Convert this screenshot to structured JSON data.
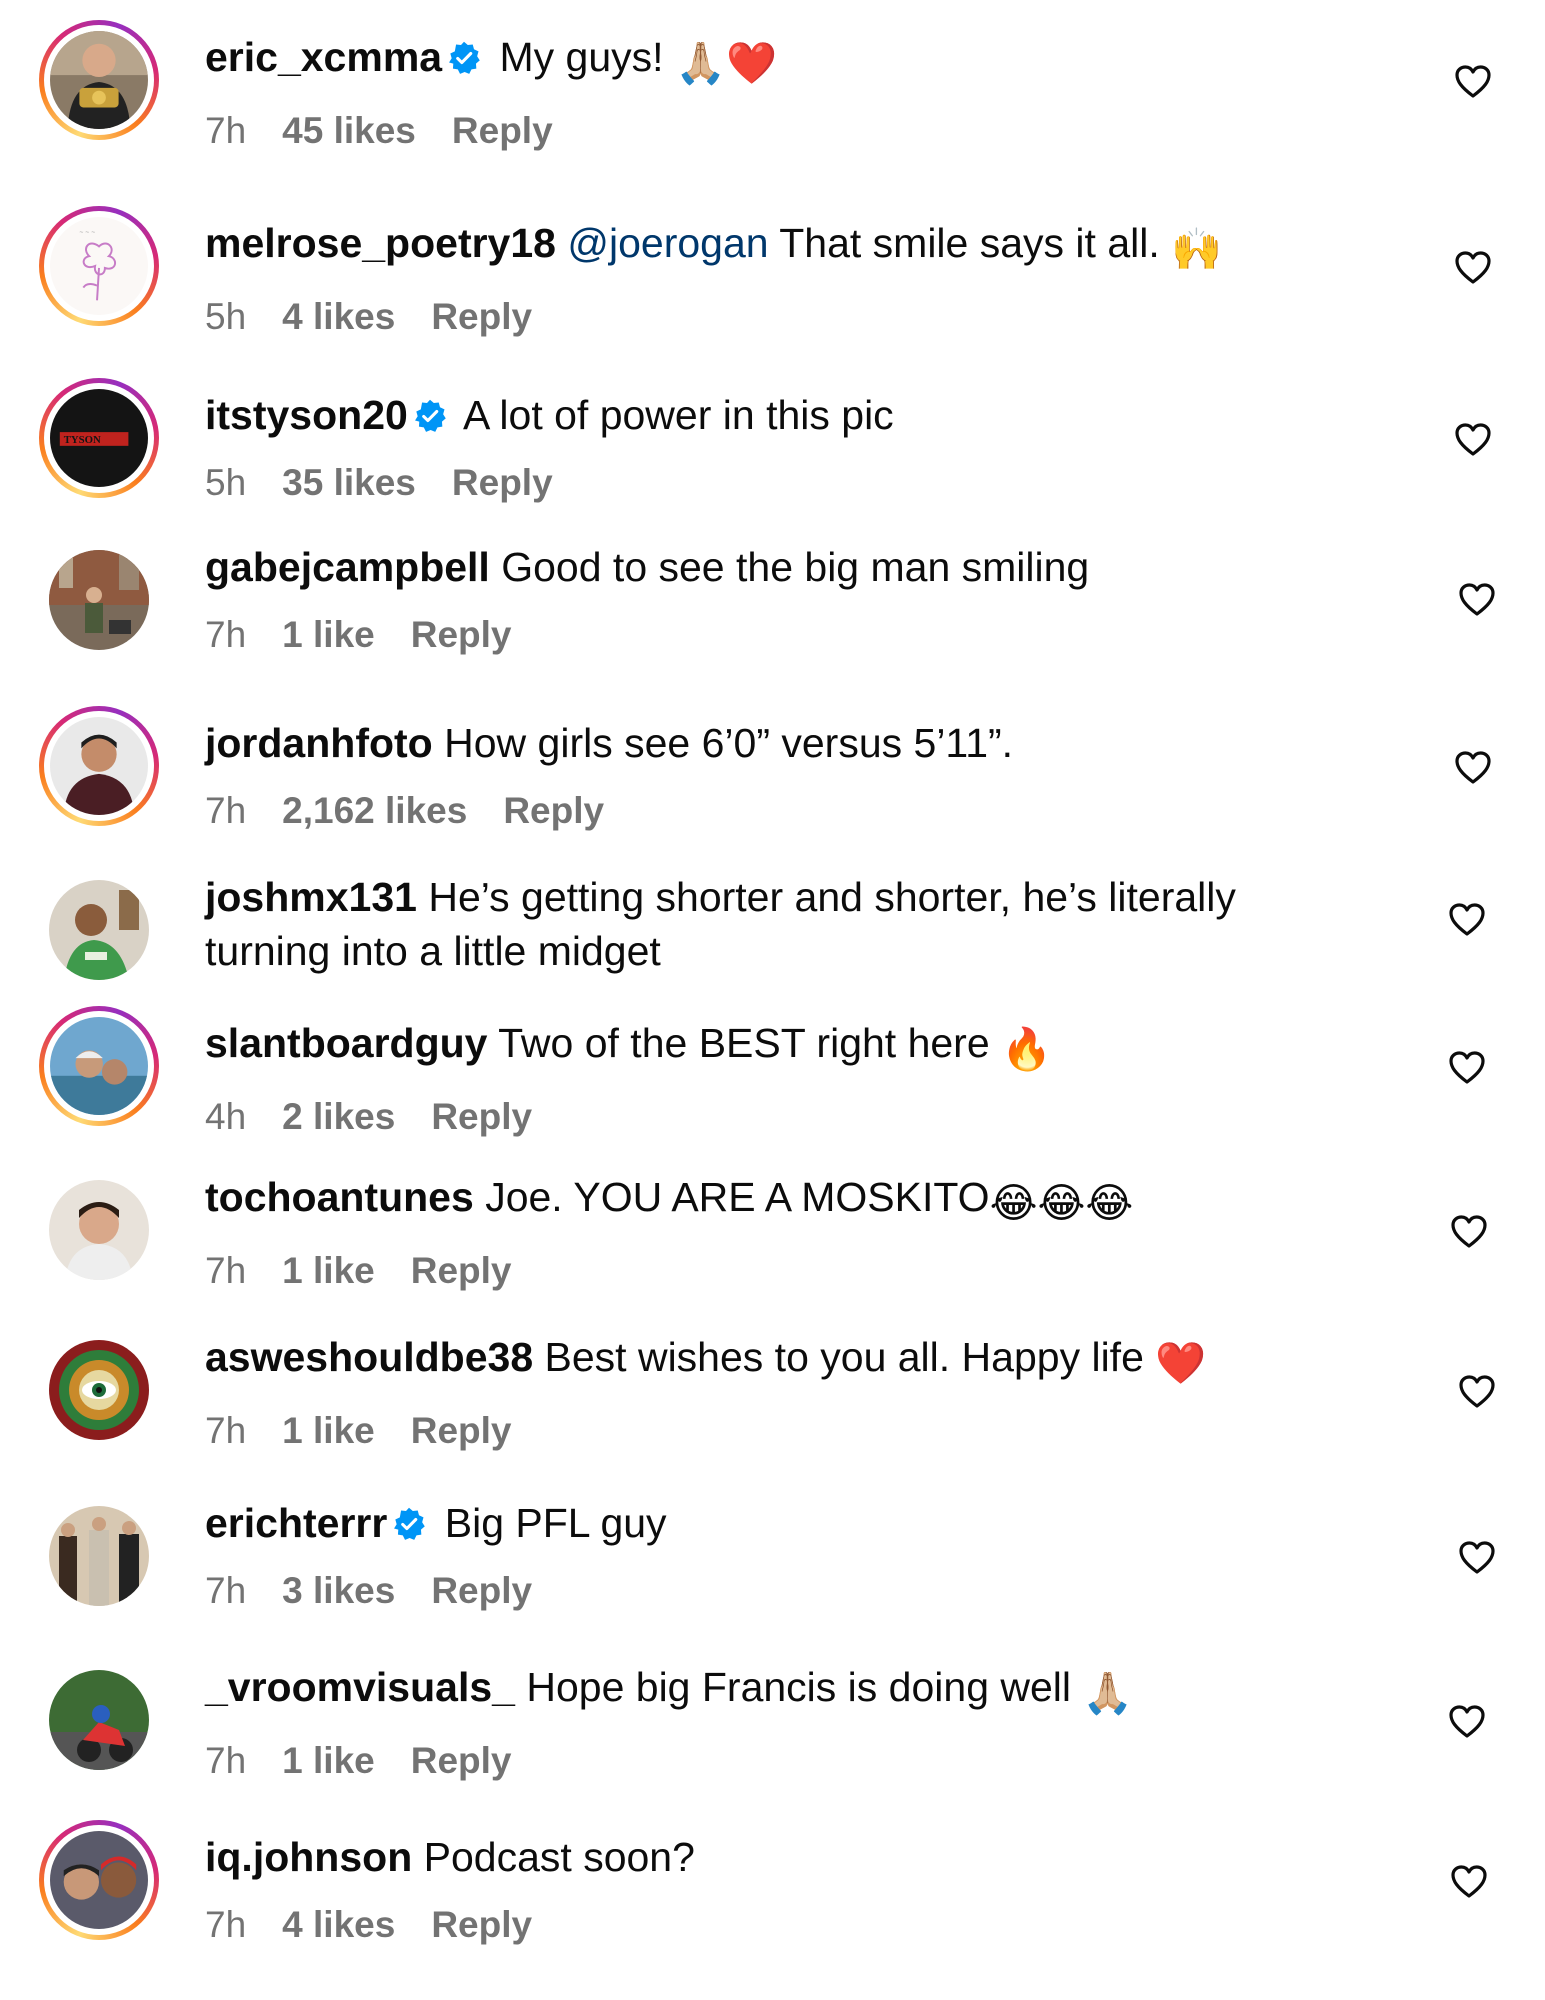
{
  "comments": [
    {
      "username": "eric_xcmma",
      "verified": true,
      "text": "My guys!",
      "emoji": "🙏🏼❤️",
      "time": "7h",
      "likes": "45 likes",
      "reply": "Reply",
      "avatar": "eric-avatar"
    },
    {
      "username": "melrose_poetry18",
      "verified": false,
      "mention": "@joerogan",
      "text": "That smile says it all.",
      "emoji": "🙌",
      "time": "5h",
      "likes": "4 likes",
      "reply": "Reply",
      "avatar": "rose-sketch-avatar"
    },
    {
      "username": "itstyson20",
      "verified": true,
      "text": "A lot of power in this pic",
      "time": "5h",
      "likes": "35 likes",
      "reply": "Reply",
      "avatar": "tyson-logo-avatar",
      "avatar_text": "TYSON"
    },
    {
      "username": "gabejcampbell",
      "verified": false,
      "text": "Good to see the big man smiling",
      "time": "7h",
      "likes": "1 like",
      "reply": "Reply",
      "avatar": "gabe-avatar"
    },
    {
      "username": "jordanhfoto",
      "verified": false,
      "text": "How girls see 6’0” versus 5’11”.",
      "time": "7h",
      "likes": "2,162 likes",
      "reply": "Reply",
      "avatar": "jordan-avatar"
    },
    {
      "username": "joshmx131",
      "verified": false,
      "text": "He’s getting shorter and shorter, he’s literally",
      "text2": "turning into a little midget",
      "time": "",
      "likes": "",
      "reply": "",
      "avatar": "josh-avatar"
    },
    {
      "username": "slantboardguy",
      "verified": false,
      "text": "Two of the BEST right here",
      "emoji": "🔥",
      "time": "4h",
      "likes": "2 likes",
      "reply": "Reply",
      "avatar": "slant-avatar"
    },
    {
      "username": "tochoantunes",
      "verified": false,
      "text": "Joe. YOU ARE A MOSKITO",
      "emoji": "😂😂😂",
      "time": "7h",
      "likes": "1 like",
      "reply": "Reply",
      "avatar": "tocho-avatar"
    },
    {
      "username": "asweshouldbe38",
      "verified": false,
      "text": "Best wishes to you all. Happy life",
      "emoji": "❤️",
      "time": "7h",
      "likes": "1 like",
      "reply": "Reply",
      "avatar": "eye-mandala-avatar"
    },
    {
      "username": "erichterrr",
      "verified": true,
      "text": "Big PFL guy",
      "time": "7h",
      "likes": "3 likes",
      "reply": "Reply",
      "avatar": "erich-avatar"
    },
    {
      "username": "_vroomvisuals_",
      "verified": false,
      "text": "Hope big Francis is doing well",
      "emoji": "🙏🏼",
      "time": "7h",
      "likes": "1 like",
      "reply": "Reply",
      "avatar": "motorbike-avatar"
    },
    {
      "username": "iq.johnson",
      "verified": false,
      "text": "Podcast soon?",
      "time": "7h",
      "likes": "4 likes",
      "reply": "Reply",
      "avatar": "iq-avatar"
    }
  ],
  "colors": {
    "text": "#0c0c0c",
    "meta": "#737373",
    "mention": "#00376b",
    "verified": "#0095f6"
  }
}
